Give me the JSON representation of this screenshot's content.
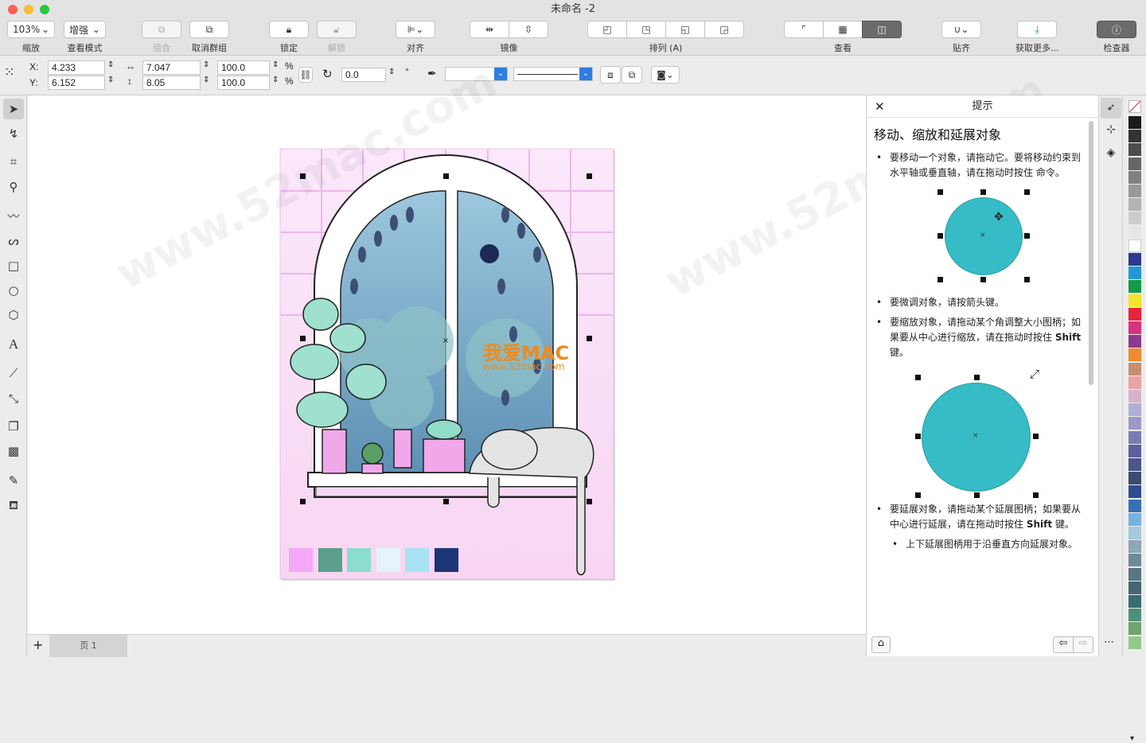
{
  "window": {
    "title": "未命名 -2"
  },
  "toolbar": {
    "zoom_value": "103%",
    "zoom_label": "缩放",
    "view_mode_value": "增强",
    "view_mode_label": "查看模式",
    "group_label": "组合",
    "ungroup_label": "取消群组",
    "lock_label": "锁定",
    "unlock_label": "解锁",
    "align_label": "对齐",
    "mirror_label": "镜像",
    "arrange_label": "排列 (A)",
    "view_label": "查看",
    "snap_label": "贴齐",
    "get_more_label": "获取更多...",
    "inspector_label": "检查器"
  },
  "properties": {
    "x_label": "X:",
    "x_value": "4.233",
    "y_label": "Y:",
    "y_value": "6.152",
    "width_value": "7.047",
    "height_value": "8.05",
    "scale_x": "100.0",
    "scale_y": "100.0",
    "percent": "%",
    "rotation_value": "0.0",
    "degree": "°"
  },
  "tips_panel": {
    "header": "提示",
    "title": "移动、缩放和延展对象",
    "tip1_a": "要移动一个对象，请拖动它。要将移动约束到水平轴或垂直轴，请在拖动时按住",
    "tip1_b": " 命令。",
    "tip2": "要微调对象，请按箭头键。",
    "tip3_a": "要缩放对象，请拖动某个角调整大小图柄；如果要从中心进行缩放，请在拖动时按住 ",
    "tip3_key": "Shift",
    "tip3_b": " 键。",
    "tip4_a": "要延展对象，请拖动某个延展图柄；如果要从中心进行延展，请在拖动时按住 ",
    "tip4_key": "Shift",
    "tip4_b": " 键。",
    "tip5": "上下延展图柄用于沿垂直方向延展对象。",
    "circle_color": "#36bcc6"
  },
  "page_tab": {
    "add": "+",
    "label": "页 1"
  },
  "watermark": {
    "text": "www.52mac.com",
    "logo": "我爱MAC",
    "url": "www.52mac.com"
  },
  "artwork_swatches": [
    "#f5a8f5",
    "#5a9e8c",
    "#8cdccf",
    "#e4f4fa",
    "#a9e2f5",
    "#1c3577"
  ],
  "palette_colors": [
    "#1a1a1a",
    "#333333",
    "#4d4d4d",
    "#666666",
    "#808080",
    "#999999",
    "#b3b3b3",
    "#cccccc",
    "#e6e6e6",
    "#ffffff",
    "#2a3a8e",
    "#1e9ad6",
    "#149a4a",
    "#f3e52a",
    "#e8233a",
    "#d6337e",
    "#8b3a8f",
    "#ee8b2d",
    "#c88e74",
    "#e9a3a0",
    "#d5b2cd",
    "#b1aed4",
    "#9a99c9",
    "#7b7bb4",
    "#5d5f9e",
    "#4c5687",
    "#3d4a6f",
    "#2e4d8f",
    "#3870b8",
    "#74b3e0",
    "#a6c8d9",
    "#8ea6b5",
    "#6e8a97",
    "#587582",
    "#466470",
    "#3a6c6f",
    "#4e8f7b",
    "#6ca36f",
    "#95c98b"
  ]
}
